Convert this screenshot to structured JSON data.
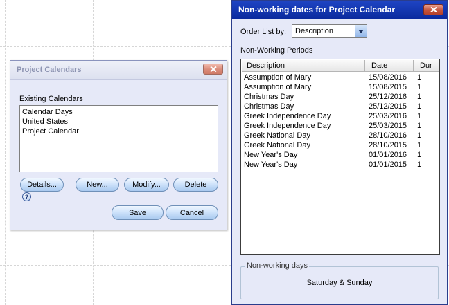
{
  "project_calendars": {
    "title": "Project Calendars",
    "existing_label": "Existing Calendars",
    "calendars": [
      "Calendar Days",
      "United States",
      "Project Calendar"
    ],
    "buttons": {
      "details": "Details...",
      "new": "New...",
      "modify": "Modify...",
      "delete": "Delete",
      "save": "Save",
      "cancel": "Cancel"
    },
    "help_glyph": "?"
  },
  "non_working_dates": {
    "title": "Non-working dates for Project Calendar",
    "order_label": "Order List by:",
    "order_value": "Description",
    "periods_label": "Non-Working Periods",
    "columns": {
      "description": "Description",
      "date": "Date",
      "dur": "Dur"
    },
    "rows": [
      {
        "description": "Assumption of Mary",
        "date": "15/08/2016",
        "dur": "1"
      },
      {
        "description": "Assumption of Mary",
        "date": "15/08/2015",
        "dur": "1"
      },
      {
        "description": "Christmas Day",
        "date": "25/12/2016",
        "dur": "1"
      },
      {
        "description": "Christmas Day",
        "date": "25/12/2015",
        "dur": "1"
      },
      {
        "description": "Greek Independence Day",
        "date": "25/03/2016",
        "dur": "1"
      },
      {
        "description": "Greek Independence Day",
        "date": "25/03/2015",
        "dur": "1"
      },
      {
        "description": "Greek National Day",
        "date": "28/10/2016",
        "dur": "1"
      },
      {
        "description": "Greek National Day",
        "date": "28/10/2015",
        "dur": "1"
      },
      {
        "description": "New Year's Day",
        "date": "01/01/2016",
        "dur": "1"
      },
      {
        "description": "New Year's Day",
        "date": "01/01/2015",
        "dur": "1"
      }
    ],
    "group_label": "Non-working days",
    "group_value": "Saturday & Sunday"
  },
  "colors": {
    "dialog_bg": "#e6e9f8",
    "active_title": "#0a2a9e",
    "inactive_title_text": "#8d94b2",
    "close_button": "#c5533c",
    "button_blue": "#cfe3fb"
  }
}
